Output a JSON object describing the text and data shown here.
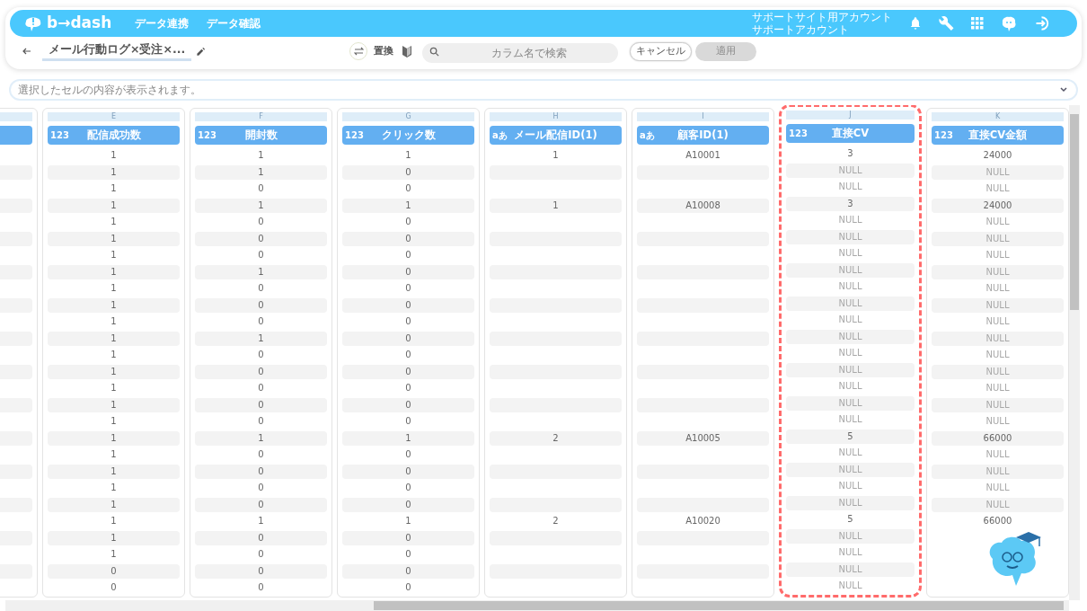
{
  "navbar": {
    "logo_text": "b→dash",
    "menu": [
      "データ連携",
      "データ確認"
    ],
    "account": [
      "サポートサイト用アカウント",
      "サポートアカウント"
    ]
  },
  "toolbar": {
    "title": "メール行動ログ×受注×...",
    "replace_label": "置換",
    "search": {
      "placeholder": "カラム名で検索"
    },
    "buttons": [
      {
        "label": "キャンセル",
        "disabled": false
      },
      {
        "label": "適用",
        "disabled": true
      }
    ]
  },
  "formula_bar": {
    "placeholder": "選択したセルの内容が表示されます。"
  },
  "columns": [
    {
      "letter": "E",
      "type_label": "123",
      "name": "配信成功数",
      "highlighted": false,
      "cells": [
        "1",
        "1",
        "1",
        "1",
        "1",
        "1",
        "1",
        "1",
        "1",
        "1",
        "1",
        "1",
        "1",
        "1",
        "1",
        "1",
        "1",
        "1",
        "1",
        "1",
        "1",
        "1",
        "1",
        "1",
        "1",
        "0",
        "0"
      ]
    },
    {
      "letter": "F",
      "type_label": "123",
      "name": "開封数",
      "highlighted": false,
      "cells": [
        "1",
        "1",
        "0",
        "1",
        "0",
        "0",
        "0",
        "1",
        "0",
        "0",
        "0",
        "1",
        "0",
        "0",
        "0",
        "0",
        "0",
        "1",
        "0",
        "0",
        "0",
        "0",
        "1",
        "0",
        "0",
        "0",
        "0"
      ]
    },
    {
      "letter": "G",
      "type_label": "123",
      "name": "クリック数",
      "highlighted": false,
      "cells": [
        "1",
        "0",
        "0",
        "1",
        "0",
        "0",
        "0",
        "0",
        "0",
        "0",
        "0",
        "0",
        "0",
        "0",
        "0",
        "0",
        "0",
        "1",
        "0",
        "0",
        "0",
        "0",
        "1",
        "0",
        "0",
        "0",
        "0"
      ]
    },
    {
      "letter": "H",
      "type_label": "aあ",
      "name": "メール配信ID(1)",
      "highlighted": false,
      "cells": [
        "1",
        "",
        "",
        "1",
        "",
        "",
        "",
        "",
        "",
        "",
        "",
        "",
        "",
        "",
        "",
        "",
        "",
        "2",
        "",
        "",
        "",
        "",
        "2",
        "",
        "",
        "",
        ""
      ]
    },
    {
      "letter": "I",
      "type_label": "aあ",
      "name": "顧客ID(1)",
      "highlighted": false,
      "cells": [
        "A10001",
        "",
        "",
        "A10008",
        "",
        "",
        "",
        "",
        "",
        "",
        "",
        "",
        "",
        "",
        "",
        "",
        "",
        "A10005",
        "",
        "",
        "",
        "",
        "A10020",
        "",
        "",
        "",
        ""
      ]
    },
    {
      "letter": "J",
      "type_label": "123",
      "name": "直接CV",
      "highlighted": true,
      "cells": [
        "3",
        {
          "text": "NULL",
          "is_null": true
        },
        {
          "text": "NULL",
          "is_null": true
        },
        "3",
        {
          "text": "NULL",
          "is_null": true
        },
        {
          "text": "NULL",
          "is_null": true
        },
        {
          "text": "NULL",
          "is_null": true
        },
        {
          "text": "NULL",
          "is_null": true
        },
        {
          "text": "NULL",
          "is_null": true
        },
        {
          "text": "NULL",
          "is_null": true
        },
        {
          "text": "NULL",
          "is_null": true
        },
        {
          "text": "NULL",
          "is_null": true
        },
        {
          "text": "NULL",
          "is_null": true
        },
        {
          "text": "NULL",
          "is_null": true
        },
        {
          "text": "NULL",
          "is_null": true
        },
        {
          "text": "NULL",
          "is_null": true
        },
        {
          "text": "NULL",
          "is_null": true
        },
        "5",
        {
          "text": "NULL",
          "is_null": true
        },
        {
          "text": "NULL",
          "is_null": true
        },
        {
          "text": "NULL",
          "is_null": true
        },
        {
          "text": "NULL",
          "is_null": true
        },
        "5",
        {
          "text": "NULL",
          "is_null": true
        },
        {
          "text": "NULL",
          "is_null": true
        },
        {
          "text": "NULL",
          "is_null": true
        },
        {
          "text": "NULL",
          "is_null": true
        }
      ]
    },
    {
      "letter": "K",
      "type_label": "123",
      "name": "直接CV金額",
      "highlighted": false,
      "cells": [
        "24000",
        {
          "text": "NULL",
          "is_null": true
        },
        {
          "text": "NULL",
          "is_null": true
        },
        "24000",
        {
          "text": "NULL",
          "is_null": true
        },
        {
          "text": "NULL",
          "is_null": true
        },
        {
          "text": "NULL",
          "is_null": true
        },
        {
          "text": "NULL",
          "is_null": true
        },
        {
          "text": "NULL",
          "is_null": true
        },
        {
          "text": "NULL",
          "is_null": true
        },
        {
          "text": "NULL",
          "is_null": true
        },
        {
          "text": "NULL",
          "is_null": true
        },
        {
          "text": "NULL",
          "is_null": true
        },
        {
          "text": "NULL",
          "is_null": true
        },
        {
          "text": "NULL",
          "is_null": true
        },
        {
          "text": "NULL",
          "is_null": true
        },
        {
          "text": "NULL",
          "is_null": true
        },
        "66000",
        {
          "text": "NULL",
          "is_null": true
        },
        {
          "text": "NULL",
          "is_null": true
        },
        {
          "text": "NULL",
          "is_null": true
        },
        {
          "text": "NULL",
          "is_null": true
        },
        "66000"
      ]
    }
  ]
}
